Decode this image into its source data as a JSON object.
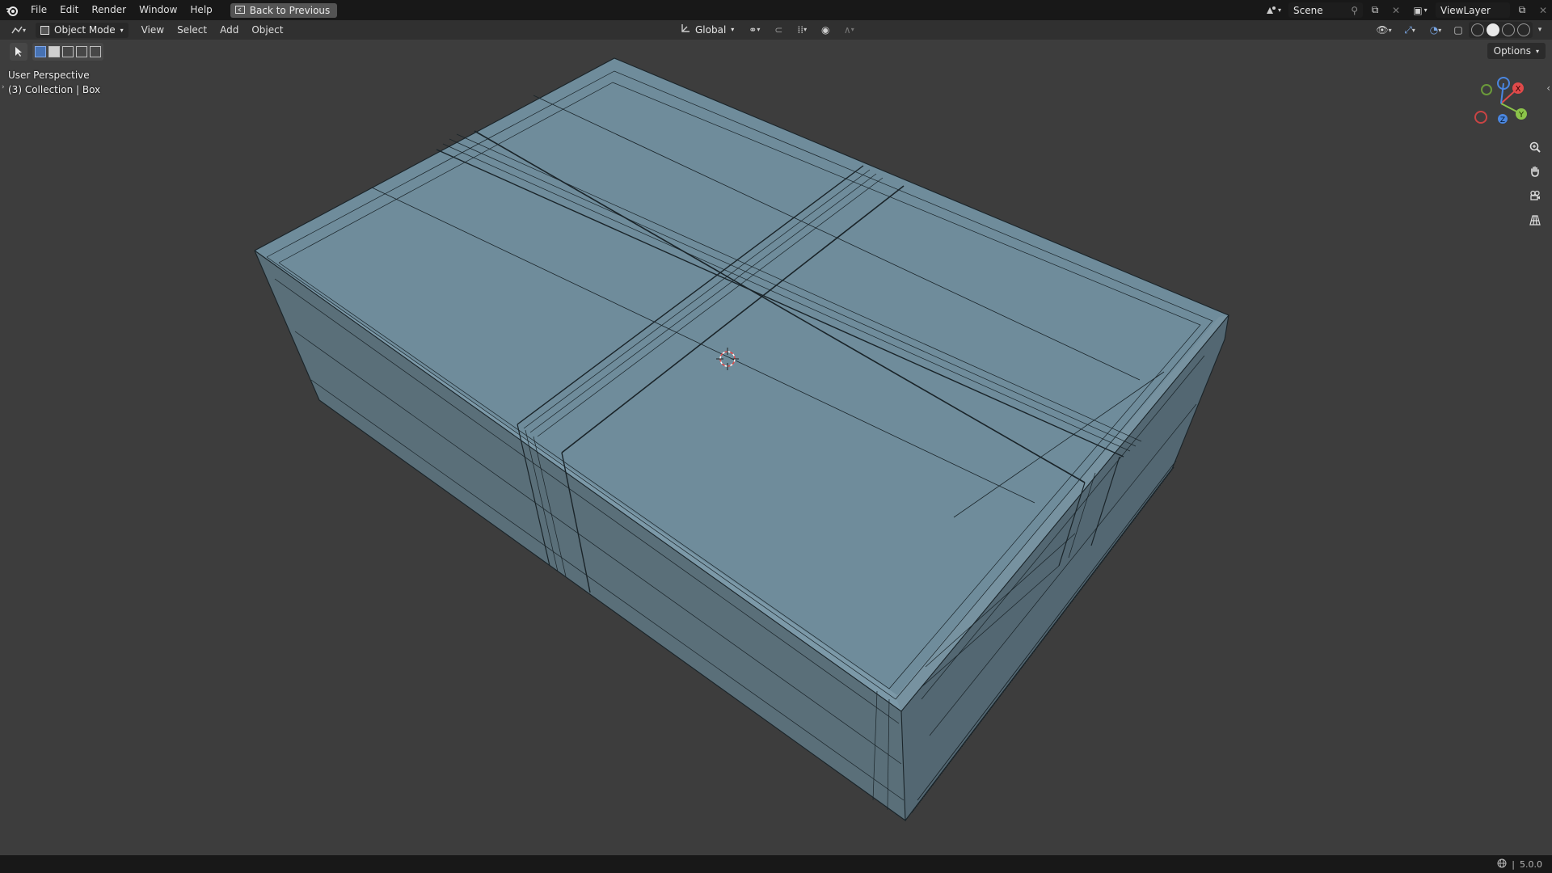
{
  "topbar": {
    "menus": [
      "File",
      "Edit",
      "Render",
      "Window",
      "Help"
    ],
    "back_label": "Back to Previous",
    "scene_name": "Scene",
    "view_layer": "ViewLayer"
  },
  "header": {
    "mode_label": "Object Mode",
    "menus": [
      "View",
      "Select",
      "Add",
      "Object"
    ],
    "orientation": "Global"
  },
  "toolbar": {
    "options_label": "Options"
  },
  "viewport": {
    "perspective": "User Perspective",
    "collection_info": "(3) Collection | Box",
    "object_color": "#6f8c9b"
  },
  "gizmo": {
    "axes": [
      "X",
      "Y",
      "Z"
    ],
    "x_color": "#e04a4a",
    "y_color": "#8bc34a",
    "z_color": "#4a86e0"
  },
  "status": {
    "version": "5.0.0"
  }
}
